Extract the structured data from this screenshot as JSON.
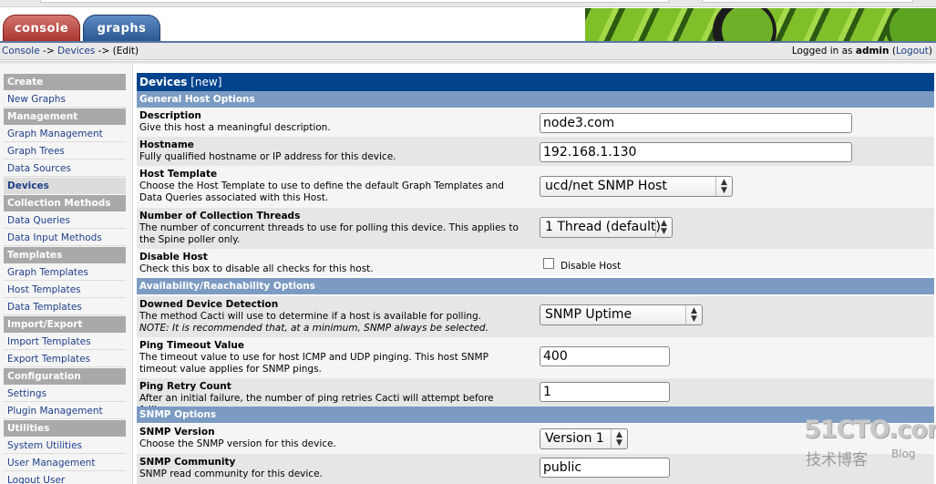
{
  "tabs": {
    "console": "console",
    "graphs": "graphs"
  },
  "breadcrumb": {
    "console": "Console",
    "sep1": " -> ",
    "devices": "Devices",
    "sep2": " -> ",
    "current": "(Edit)"
  },
  "login": {
    "prefix": "Logged in as ",
    "user": "admin",
    "open": " (",
    "logout": "Logout",
    "close": ")"
  },
  "sidebar": {
    "items": [
      {
        "label": "Create",
        "type": "header"
      },
      {
        "label": "New Graphs",
        "type": "link"
      },
      {
        "label": "Management",
        "type": "header"
      },
      {
        "label": "Graph Management",
        "type": "link"
      },
      {
        "label": "Graph Trees",
        "type": "link"
      },
      {
        "label": "Data Sources",
        "type": "link"
      },
      {
        "label": "Devices",
        "type": "active"
      },
      {
        "label": "Collection Methods",
        "type": "header"
      },
      {
        "label": "Data Queries",
        "type": "link"
      },
      {
        "label": "Data Input Methods",
        "type": "link"
      },
      {
        "label": "Templates",
        "type": "header"
      },
      {
        "label": "Graph Templates",
        "type": "link"
      },
      {
        "label": "Host Templates",
        "type": "link"
      },
      {
        "label": "Data Templates",
        "type": "link"
      },
      {
        "label": "Import/Export",
        "type": "header"
      },
      {
        "label": "Import Templates",
        "type": "link"
      },
      {
        "label": "Export Templates",
        "type": "link"
      },
      {
        "label": "Configuration",
        "type": "header"
      },
      {
        "label": "Settings",
        "type": "link"
      },
      {
        "label": "Plugin Management",
        "type": "link"
      },
      {
        "label": "Utilities",
        "type": "header"
      },
      {
        "label": "System Utilities",
        "type": "link"
      },
      {
        "label": "User Management",
        "type": "link"
      },
      {
        "label": "Logout User",
        "type": "link"
      }
    ]
  },
  "main": {
    "title": "Devices",
    "title_suffix": " [new]",
    "sections": {
      "general": "General Host Options",
      "availability": "Availability/Reachability Options",
      "snmp": "SNMP Options"
    },
    "fields": {
      "description": {
        "name": "Description",
        "help": "Give this host a meaningful description.",
        "value": "node3.com"
      },
      "hostname": {
        "name": "Hostname",
        "help": "Fully qualified hostname or IP address for this device.",
        "value": "192.168.1.130"
      },
      "host_template": {
        "name": "Host Template",
        "help": "Choose the Host Template to use to define the default Graph Templates and Data Queries associated with this Host.",
        "value": "ucd/net SNMP Host"
      },
      "threads": {
        "name": "Number of Collection Threads",
        "help": "The number of concurrent threads to use for polling this device. This applies to the Spine poller only.",
        "value": "1 Thread (default)"
      },
      "disable_host": {
        "name": "Disable Host",
        "help": "Check this box to disable all checks for this host.",
        "checkbox_label": "Disable Host",
        "checked": false
      },
      "downed_detection": {
        "name": "Downed Device Detection",
        "help": "The method Cacti will use to determine if a host is available for polling.",
        "note": "NOTE: It is recommended that, at a minimum, SNMP always be selected.",
        "value": "SNMP Uptime"
      },
      "ping_timeout": {
        "name": "Ping Timeout Value",
        "help": "The timeout value to use for host ICMP and UDP pinging. This host SNMP timeout value applies for SNMP pings.",
        "value": "400"
      },
      "ping_retry": {
        "name": "Ping Retry Count",
        "help": "After an initial failure, the number of ping retries Cacti will attempt before failing.",
        "value": "1"
      },
      "snmp_version": {
        "name": "SNMP Version",
        "help": "Choose the SNMP version for this device.",
        "value": "Version 1"
      },
      "snmp_community": {
        "name": "SNMP Community",
        "help": "SNMP read community for this device.",
        "value": "public"
      }
    }
  },
  "watermark": {
    "top": "51CTO.com",
    "bottom": "技术博客",
    "blog": "Blog"
  },
  "icons": {
    "select_arrows": "updown-chevron-icon"
  },
  "colors": {
    "title_bar": "#00438c",
    "section_bar": "#7b9bc2",
    "menu_header": "#a9a9a9",
    "link": "#1e3f8a",
    "tab_console": "#b33a33",
    "tab_graphs": "#2f5d99"
  }
}
